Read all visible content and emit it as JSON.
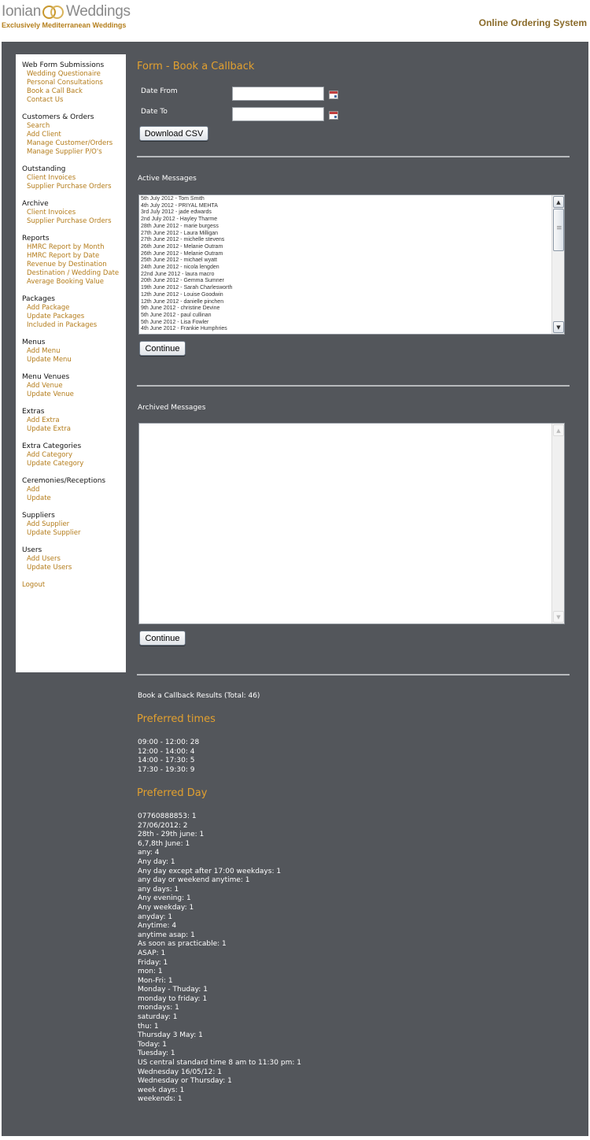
{
  "header": {
    "brand_left": "Ionian",
    "brand_right": "Weddings",
    "tagline": "Exclusively Mediterranean Weddings",
    "system_title": "Online Ordering System"
  },
  "sidebar": {
    "groups": [
      {
        "heading": "Web Form Submissions",
        "links": [
          "Wedding Questionaire",
          "Personal Consultations",
          "Book a Call Back",
          "Contact Us"
        ]
      },
      {
        "heading": "Customers & Orders",
        "links": [
          "Search",
          "Add Client",
          "Manage Customer/Orders",
          "Manage Supplier P/O's"
        ]
      },
      {
        "heading": "Outstanding",
        "links": [
          "Client Invoices",
          "Supplier Purchase Orders"
        ]
      },
      {
        "heading": "Archive",
        "links": [
          "Client Invoices",
          "Supplier Purchase Orders"
        ]
      },
      {
        "heading": "Reports",
        "links": [
          "HMRC Report by Month",
          "HMRC Report by Date",
          "Revenue by Destination",
          "Destination / Wedding Date",
          "Average Booking Value"
        ]
      },
      {
        "heading": "Packages",
        "links": [
          "Add Package",
          "Update Packages",
          "Included in Packages"
        ]
      },
      {
        "heading": "Menus",
        "links": [
          "Add Menu",
          "Update Menu"
        ]
      },
      {
        "heading": "Menu Venues",
        "links": [
          "Add Venue",
          "Update Venue"
        ]
      },
      {
        "heading": "Extras",
        "links": [
          "Add Extra",
          "Update Extra"
        ]
      },
      {
        "heading": "Extra Categories",
        "links": [
          "Add Category",
          "Update Category"
        ]
      },
      {
        "heading": "Ceremonies/Receptions",
        "links": [
          "Add",
          "Update"
        ]
      },
      {
        "heading": "Suppliers",
        "links": [
          "Add Supplier",
          "Update Supplier"
        ]
      },
      {
        "heading": "Users",
        "links": [
          "Add Users",
          "Update Users"
        ]
      }
    ],
    "logout": "Logout"
  },
  "form": {
    "title": "Form - Book a Callback",
    "date_from_label": "Date From",
    "date_to_label": "Date To",
    "date_from_value": "",
    "date_to_value": "",
    "download_label": "Download CSV"
  },
  "active": {
    "label": "Active Messages",
    "items": [
      "5th July 2012 - Tom Smith",
      "4th July 2012 - PRIYAL MEHTA",
      "3rd July 2012 - jade edwards",
      "2nd July 2012 - Hayley Tharme",
      "28th June 2012 - marie burgess",
      "27th June 2012 - Laura Milligan",
      "27th June 2012 - michelle stevens",
      "26th June 2012 - Melanie Outram",
      "26th June 2012 - Melanie Outram",
      "25th June 2012 - michael wyatt",
      "24th June 2012 - nicola lengden",
      "22nd June 2012 - laura macro",
      "20th June 2012 - Gemma Sumner",
      "19th June 2012 - Sarah Charlesworth",
      "12th June 2012 - Louise Goodwin",
      "12th June 2012 - danielle pinchen",
      "9th June 2012 - christine Devine",
      "5th June 2012 - paul cullinan",
      "5th June 2012 - Lisa Fowler",
      "4th June 2012 - Frankie Humphries"
    ],
    "continue_label": "Continue"
  },
  "archived": {
    "label": "Archived Messages",
    "items": [],
    "continue_label": "Continue"
  },
  "results": {
    "title": "Book a Callback Results (Total: 46)",
    "times_heading": "Preferred times",
    "times": [
      "09:00 - 12:00: 28",
      "12:00 - 14:00: 4",
      "14:00 - 17:30: 5",
      "17:30 - 19:30: 9"
    ],
    "day_heading": "Preferred Day",
    "days": [
      "07760888853: 1",
      "27/06/2012: 2",
      "28th - 29th june: 1",
      "6,7,8th June: 1",
      "any: 4",
      "Any day: 1",
      "Any day except after 17:00 weekdays: 1",
      "any day or weekend anytime: 1",
      "any days: 1",
      "Any evening: 1",
      "Any weekday: 1",
      "anyday: 1",
      "Anytime: 4",
      "anytime asap: 1",
      "As soon as practicable: 1",
      "ASAP: 1",
      "Friday: 1",
      "mon: 1",
      "Mon-Fri: 1",
      "Monday - Thuday: 1",
      "monday to friday: 1",
      "mondays: 1",
      "saturday: 1",
      "thu: 1",
      "Thursday 3 May: 1",
      "Today: 1",
      "Tuesday: 1",
      "US central standard time 8 am to 11:30 pm: 1",
      "Wednesday 16/05/12: 1",
      "Wednesday or Thursday: 1",
      "week days: 1",
      "weekends: 1"
    ]
  },
  "colors": {
    "accent": "#e2a02f",
    "link": "#b47c1a",
    "panel_bg": "#53565b"
  }
}
